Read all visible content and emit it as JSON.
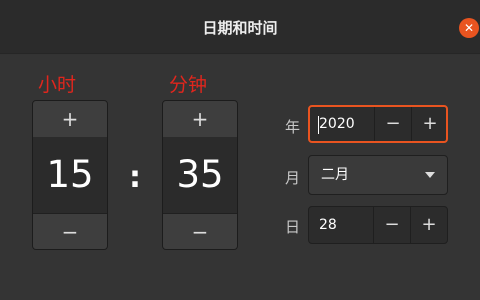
{
  "window": {
    "title": "日期和时间",
    "close_glyph": "✕"
  },
  "annotations": {
    "hour": "小时",
    "minute": "分钟"
  },
  "time": {
    "hour": "15",
    "minute": "35",
    "separator": ":",
    "increment_glyph": "+",
    "decrement_glyph": "−"
  },
  "date": {
    "year_label": "年",
    "year_value": "2020",
    "month_label": "月",
    "month_value": "二月",
    "day_label": "日",
    "day_value": "28",
    "increment_glyph": "+",
    "decrement_glyph": "−"
  },
  "colors": {
    "accent": "#e95420",
    "annotation": "#e0261d",
    "background": "#343434",
    "titlebar": "#2b2b2b"
  }
}
